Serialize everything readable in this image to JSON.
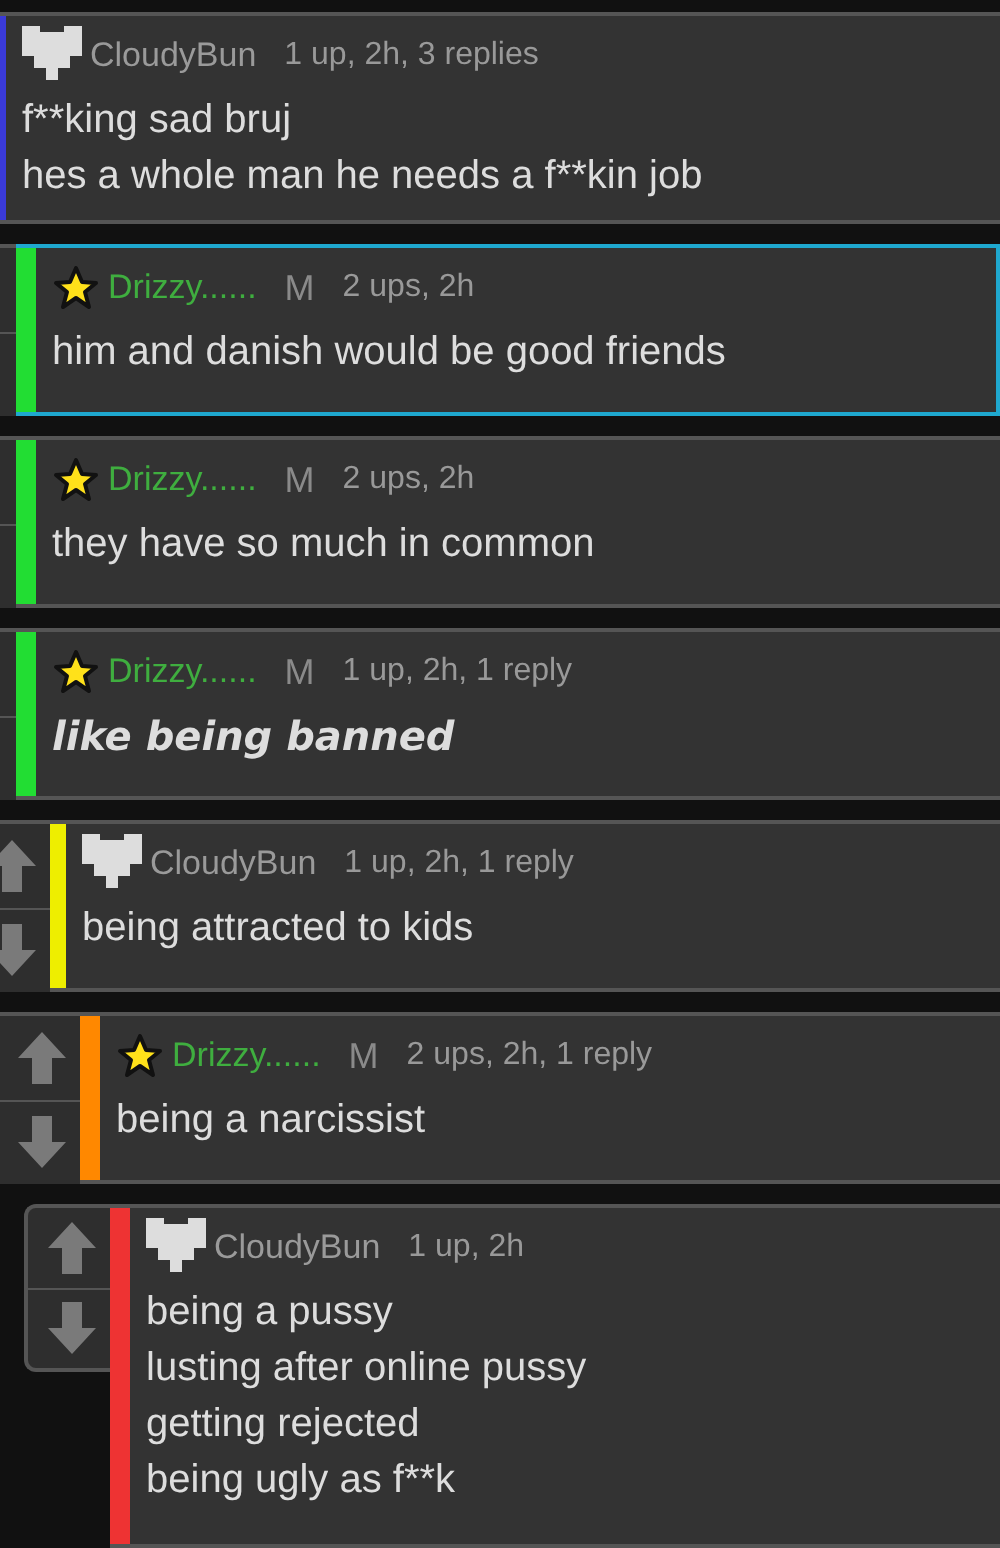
{
  "comments": [
    {
      "kind": "heart",
      "author": "CloudyBun",
      "meta": "1 up, 2h, 3 replies",
      "color": "#3a3ad8",
      "highlighted": false,
      "emphasized": false,
      "lines": [
        "f**king sad bruj",
        "hes a whole man he needs a f**kin job"
      ],
      "children": [
        {
          "kind": "star",
          "author": "Drizzy......",
          "badge": "M",
          "meta": "2 ups, 2h",
          "color": "#22dd33",
          "highlighted": true,
          "emphasized": false,
          "lines": [
            "him and danish would be good friends"
          ]
        },
        {
          "kind": "star",
          "author": "Drizzy......",
          "badge": "M",
          "meta": "2 ups, 2h",
          "color": "#22dd33",
          "highlighted": false,
          "emphasized": false,
          "lines": [
            "they have so much in common"
          ]
        },
        {
          "kind": "star",
          "author": "Drizzy......",
          "badge": "M",
          "meta": "1 up, 2h, 1 reply",
          "color": "#22dd33",
          "highlighted": false,
          "emphasized": true,
          "lines": [
            "like being banned"
          ],
          "children": [
            {
              "kind": "heart",
              "author": "CloudyBun",
              "meta": "1 up, 2h, 1 reply",
              "color": "#eeee00",
              "highlighted": false,
              "emphasized": false,
              "lines": [
                "being attracted to kids"
              ],
              "children": [
                {
                  "kind": "star",
                  "author": "Drizzy......",
                  "badge": "M",
                  "meta": "2 ups, 2h, 1 reply",
                  "color": "#ff8800",
                  "highlighted": false,
                  "emphasized": false,
                  "lines": [
                    "being a narcissist"
                  ],
                  "children": [
                    {
                      "kind": "heart",
                      "author": "CloudyBun",
                      "meta": "1 up, 2h",
                      "color": "#ee3333",
                      "highlighted": false,
                      "emphasized": false,
                      "lines": [
                        "being a pussy",
                        "lusting after online pussy",
                        "getting rejected",
                        "being ugly as f**k"
                      ]
                    }
                  ]
                }
              ]
            }
          ]
        }
      ]
    }
  ]
}
